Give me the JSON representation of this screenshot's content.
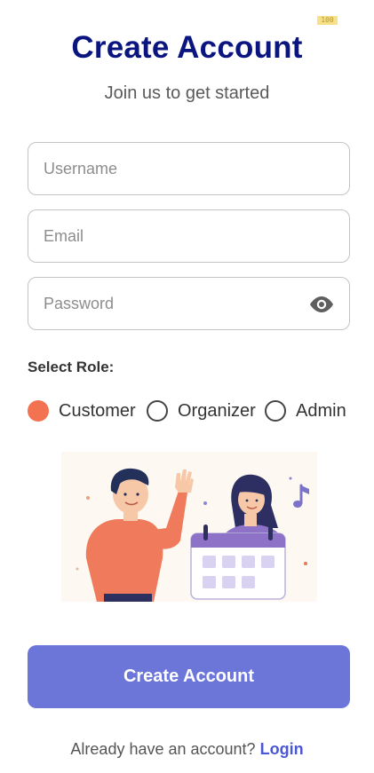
{
  "debug_badge": "100",
  "header": {
    "title": "Create Account",
    "subtitle": "Join us to get started"
  },
  "form": {
    "username": {
      "placeholder": "Username",
      "value": ""
    },
    "email": {
      "placeholder": "Email",
      "value": ""
    },
    "password": {
      "placeholder": "Password",
      "value": "",
      "visibility_icon": "eye-icon"
    }
  },
  "role": {
    "label": "Select Role:",
    "options": [
      {
        "label": "Customer",
        "selected": true
      },
      {
        "label": "Organizer",
        "selected": false
      },
      {
        "label": "Admin",
        "selected": false
      }
    ]
  },
  "illustration": {
    "icon": "people-calendar-illustration"
  },
  "actions": {
    "submit_label": "Create Account"
  },
  "footer": {
    "prompt": "Already have an account?",
    "link_label": "Login"
  },
  "colors": {
    "title": "#0b1580",
    "accent_radio": "#f27251",
    "primary_button": "#6c75d8",
    "link": "#4b56d3"
  }
}
